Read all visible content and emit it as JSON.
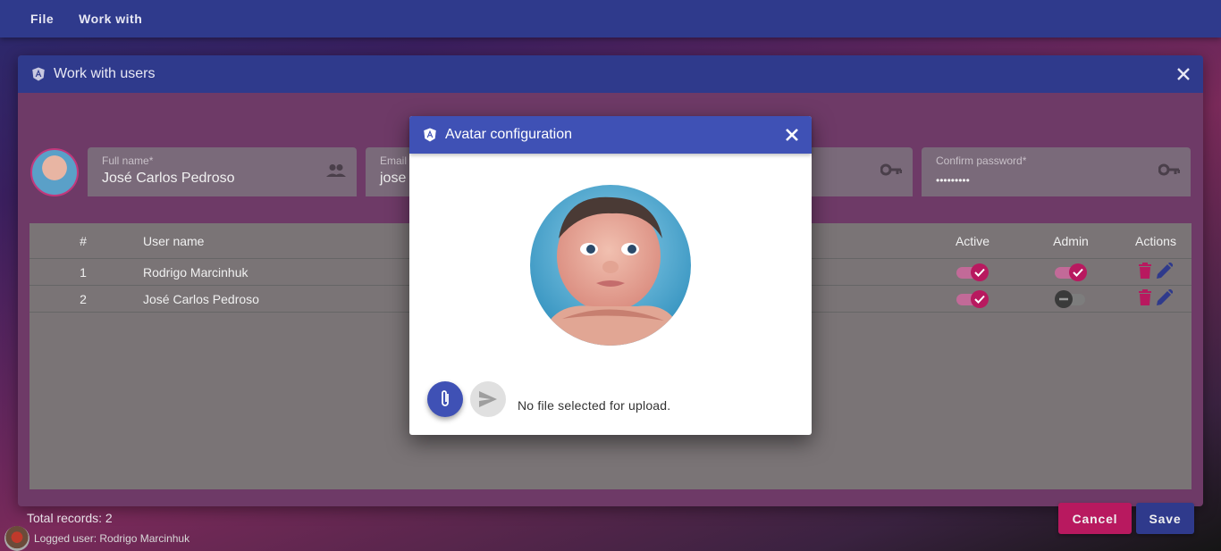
{
  "menu": {
    "items": [
      "File",
      "Work with"
    ]
  },
  "window": {
    "title": "Work with users",
    "fields": {
      "fullname_label": "Full name*",
      "fullname_value": "José Carlos Pedroso",
      "email_label": "Email",
      "email_value": "jose",
      "confirm_label": "Confirm password*",
      "confirm_value": "•••••••••"
    },
    "table": {
      "headers": [
        "#",
        "User name",
        "Active",
        "Admin",
        "Actions"
      ],
      "rows": [
        {
          "num": "1",
          "user": "Rodrigo Marcinhuk",
          "active": true,
          "admin": true
        },
        {
          "num": "2",
          "user": "José Carlos Pedroso",
          "active": true,
          "admin": false
        }
      ]
    },
    "total": "Total records: 2",
    "cancel_label": "Cancel",
    "save_label": "Save"
  },
  "dialog": {
    "title": "Avatar configuration",
    "message": "No file selected for upload."
  },
  "status": {
    "text": "Logged user: Rodrigo Marcinhuk"
  },
  "colors": {
    "primary": "#3f51b5",
    "accent": "#b8195f",
    "header": "#2f3a8c"
  },
  "icons": [
    "angular-icon",
    "close-icon",
    "people-icon",
    "key-icon",
    "check-icon",
    "minus-icon",
    "delete-icon",
    "edit-icon",
    "paperclip-icon",
    "send-icon"
  ]
}
